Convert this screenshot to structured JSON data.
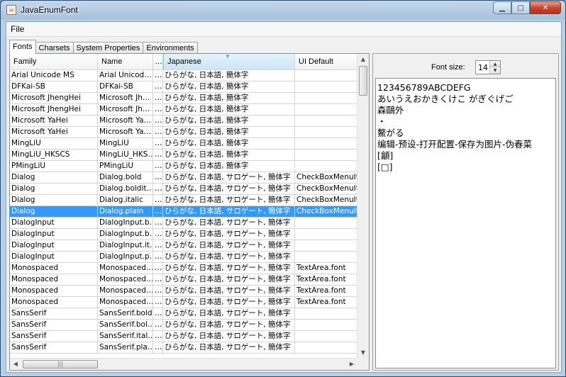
{
  "window": {
    "title": "JavaEnumFont"
  },
  "menu": {
    "file": "File"
  },
  "tabs": [
    "Fonts",
    "Charsets",
    "System Properties",
    "Environments"
  ],
  "table": {
    "columns": [
      "Family",
      "Name",
      "…",
      "Japanese",
      "UI Default"
    ],
    "rows": [
      [
        "Arial Unicode MS",
        "Arial Unicod…",
        "…",
        "ひらがな, 日本語, 簡体字",
        ""
      ],
      [
        "DFKai-SB",
        "DFKai-SB",
        "…",
        "ひらがな, 日本語, 簡体字",
        ""
      ],
      [
        "Microsoft JhengHei",
        "Microsoft Jh…",
        "…",
        "ひらがな, 日本語, 簡体字",
        ""
      ],
      [
        "Microsoft JhengHei",
        "Microsoft Jh…",
        "…",
        "ひらがな, 日本語, 簡体字",
        ""
      ],
      [
        "Microsoft YaHei",
        "Microsoft Ya…",
        "…",
        "ひらがな, 日本語, 簡体字",
        ""
      ],
      [
        "Microsoft YaHei",
        "Microsoft Ya…",
        "…",
        "ひらがな, 日本語, 簡体字",
        ""
      ],
      [
        "MingLiU",
        "MingLiU",
        "…",
        "ひらがな, 日本語, 簡体字",
        ""
      ],
      [
        "MingLiU_HKSCS",
        "MingLiU_HKS…",
        "…",
        "ひらがな, 日本語, 簡体字",
        ""
      ],
      [
        "PMingLiU",
        "PMingLiU",
        "…",
        "ひらがな, 日本語, 簡体字",
        ""
      ],
      [
        "Dialog",
        "Dialog.bold",
        "…",
        "ひらがな, 日本語, サロゲート, 簡体字",
        "CheckBoxMenuIt"
      ],
      [
        "Dialog",
        "Dialog.boldit…",
        "…",
        "ひらがな, 日本語, サロゲート, 簡体字",
        "CheckBoxMenuIt"
      ],
      [
        "Dialog",
        "Dialog.italic",
        "…",
        "ひらがな, 日本語, サロゲート, 簡体字",
        "CheckBoxMenuIt"
      ],
      [
        "Dialog",
        "Dialog.plain",
        "…",
        "ひらがな, 日本語, サロゲート, 簡体字",
        "CheckBoxMenuIt"
      ],
      [
        "DialogInput",
        "DialogInput.b…",
        "…",
        "ひらがな, 日本語, サロゲート, 簡体字",
        ""
      ],
      [
        "DialogInput",
        "DialogInput.b…",
        "…",
        "ひらがな, 日本語, サロゲート, 簡体字",
        ""
      ],
      [
        "DialogInput",
        "DialogInput.it…",
        "…",
        "ひらがな, 日本語, サロゲート, 簡体字",
        ""
      ],
      [
        "DialogInput",
        "DialogInput.p…",
        "…",
        "ひらがな, 日本語, サロゲート, 簡体字",
        ""
      ],
      [
        "Monospaced",
        "Monospaced…",
        "…",
        "ひらがな, 日本語, サロゲート, 簡体字",
        "TextArea.font"
      ],
      [
        "Monospaced",
        "Monospaced…",
        "…",
        "ひらがな, 日本語, サロゲート, 簡体字",
        "TextArea.font"
      ],
      [
        "Monospaced",
        "Monospaced…",
        "…",
        "ひらがな, 日本語, サロゲート, 簡体字",
        "TextArea.font"
      ],
      [
        "Monospaced",
        "Monospaced…",
        "…",
        "ひらがな, 日本語, サロゲート, 簡体字",
        "TextArea.font"
      ],
      [
        "SansSerif",
        "SansSerif.bold",
        "…",
        "ひらがな, 日本語, サロゲート, 簡体字",
        ""
      ],
      [
        "SansSerif",
        "SansSerif.bol…",
        "…",
        "ひらがな, 日本語, サロゲート, 簡体字",
        ""
      ],
      [
        "SansSerif",
        "SansSerif.ital…",
        "…",
        "ひらがな, 日本語, サロゲート, 簡体字",
        ""
      ],
      [
        "SansSerif",
        "SansSerif.pla…",
        "…",
        "ひらがな, 日本語, サロゲート, 簡体字",
        ""
      ]
    ],
    "selected_index": 12
  },
  "font_size": {
    "label": "Font size:",
    "value": "14"
  },
  "preview_lines": [
    "123456789ABCDEFG",
    "あいうえおかきくけこ がぎぐげご",
    "森鷗外",
    "・",
    "鰲がる",
    "编辑-预设-打开配置-保存为图片-伪春菜",
    "[龥]",
    "[□]"
  ],
  "colors": {
    "selection": "#3399ff",
    "sorted_header": "#cde6f7"
  }
}
